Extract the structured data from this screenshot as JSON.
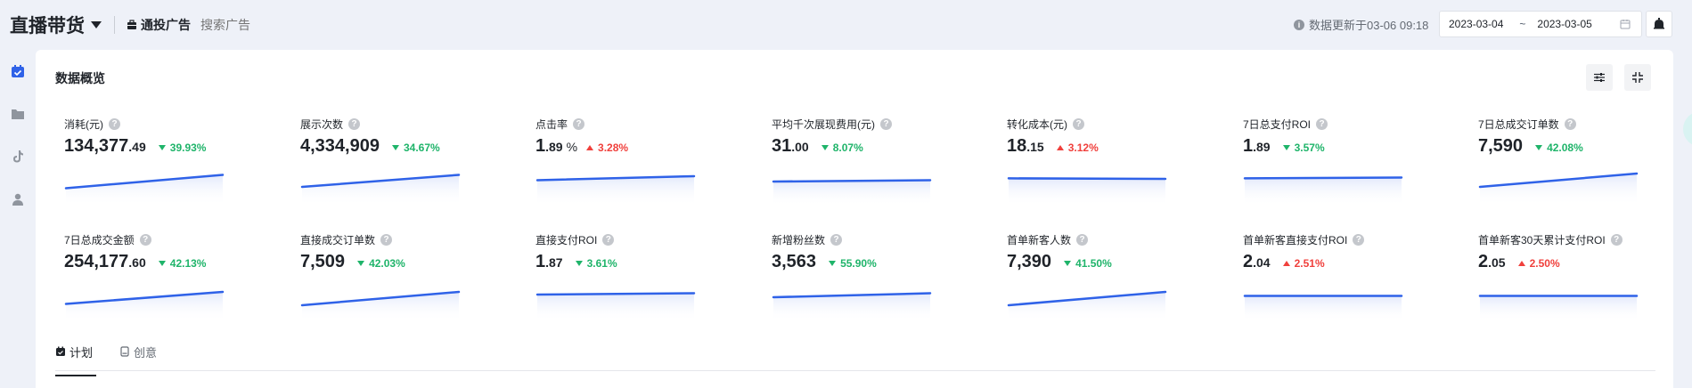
{
  "header": {
    "brand": "直播带货",
    "ad_type": "通投广告",
    "search_placeholder": "搜索广告",
    "update_info": "数据更新于03-06 09:18",
    "date_start": "2023-03-04",
    "date_sep": "~",
    "date_end": "2023-03-05"
  },
  "panel": {
    "title": "数据概览"
  },
  "colors": {
    "accent": "#2f62e8",
    "down": "#1fb46a",
    "up": "#f0403c"
  },
  "metrics": [
    {
      "label": "消耗(元)",
      "int": "134,377",
      "dec": ".49",
      "unit": "",
      "change": "39.93%",
      "dir": "down",
      "trend": [
        0.25,
        0.75
      ]
    },
    {
      "label": "展示次数",
      "int": "4,334,909",
      "dec": "",
      "unit": "",
      "change": "34.67%",
      "dir": "down",
      "trend": [
        0.3,
        0.75
      ]
    },
    {
      "label": "点击率",
      "int": "1",
      "dec": ".89",
      "unit": "%",
      "change": "3.28%",
      "dir": "up",
      "trend": [
        0.55,
        0.7
      ]
    },
    {
      "label": "平均千次展现费用(元)",
      "int": "31",
      "dec": ".00",
      "unit": "",
      "change": "8.07%",
      "dir": "down",
      "trend": [
        0.5,
        0.55
      ]
    },
    {
      "label": "转化成本(元)",
      "int": "18",
      "dec": ".15",
      "unit": "",
      "change": "3.12%",
      "dir": "up",
      "trend": [
        0.62,
        0.6
      ]
    },
    {
      "label": "7日总支付ROI",
      "int": "1",
      "dec": ".89",
      "unit": "",
      "change": "3.57%",
      "dir": "down",
      "trend": [
        0.62,
        0.65
      ]
    },
    {
      "label": "7日总成交订单数",
      "int": "7,590",
      "dec": "",
      "unit": "",
      "change": "42.08%",
      "dir": "down",
      "trend": [
        0.3,
        0.8
      ]
    },
    {
      "label": "7日总成交金额",
      "int": "254,177",
      "dec": ".60",
      "unit": "",
      "change": "42.13%",
      "dir": "down",
      "trend": [
        0.25,
        0.7
      ]
    },
    {
      "label": "直接成交订单数",
      "int": "7,509",
      "dec": "",
      "unit": "",
      "change": "42.03%",
      "dir": "down",
      "trend": [
        0.2,
        0.7
      ]
    },
    {
      "label": "直接支付ROI",
      "int": "1",
      "dec": ".87",
      "unit": "",
      "change": "3.61%",
      "dir": "down",
      "trend": [
        0.6,
        0.65
      ]
    },
    {
      "label": "新增粉丝数",
      "int": "3,563",
      "dec": "",
      "unit": "",
      "change": "55.90%",
      "dir": "down",
      "trend": [
        0.5,
        0.65
      ]
    },
    {
      "label": "首单新客人数",
      "int": "7,390",
      "dec": "",
      "unit": "",
      "change": "41.50%",
      "dir": "down",
      "trend": [
        0.2,
        0.7
      ]
    },
    {
      "label": "首单新客直接支付ROI",
      "int": "2",
      "dec": ".04",
      "unit": "",
      "change": "2.51%",
      "dir": "up",
      "trend": [
        0.55,
        0.55
      ]
    },
    {
      "label": "首单新客30天累计支付ROI",
      "int": "2",
      "dec": ".05",
      "unit": "",
      "change": "2.50%",
      "dir": "up",
      "trend": [
        0.55,
        0.55
      ]
    }
  ],
  "tabs": [
    {
      "label": "计划",
      "active": true
    },
    {
      "label": "创意",
      "active": false
    }
  ]
}
